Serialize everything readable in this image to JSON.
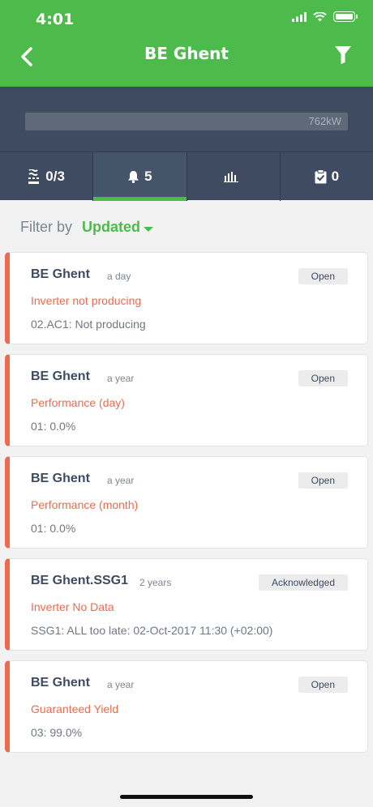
{
  "status_bar": {
    "time": "4:01"
  },
  "header": {
    "title": "BE Ghent"
  },
  "summary": {
    "power_label": "762kW"
  },
  "tabs": [
    {
      "icon": "inverter-icon",
      "value": "0/3"
    },
    {
      "icon": "bell-icon",
      "value": "5"
    },
    {
      "icon": "bar-chart-icon",
      "value": ""
    },
    {
      "icon": "clipboard-check-icon",
      "value": "0"
    }
  ],
  "filter": {
    "label": "Filter by",
    "value": "Updated"
  },
  "alerts": [
    {
      "site": "BE Ghent",
      "time": "a day",
      "status": "Open",
      "alert": "Inverter not producing",
      "detail": "02.AC1: Not producing"
    },
    {
      "site": "BE Ghent",
      "time": "a year",
      "status": "Open",
      "alert": "Performance (day)",
      "detail": "01: 0.0%"
    },
    {
      "site": "BE Ghent",
      "time": "a year",
      "status": "Open",
      "alert": "Performance (month)",
      "detail": "01: 0.0%"
    },
    {
      "site": "BE Ghent.SSG1",
      "time": "2 years",
      "status": "Acknowledged",
      "alert": "Inverter No Data",
      "detail": "SSG1: ALL too late: 02-Oct-2017 11:30 (+02:00)"
    },
    {
      "site": "BE Ghent",
      "time": "a year",
      "status": "Open",
      "alert": "Guaranteed Yield",
      "detail": "03: 99.0%"
    }
  ],
  "colors": {
    "brand_green": "#4cbb4c",
    "header_dark": "#3e4b60",
    "alert_red": "#ee6a4e"
  }
}
